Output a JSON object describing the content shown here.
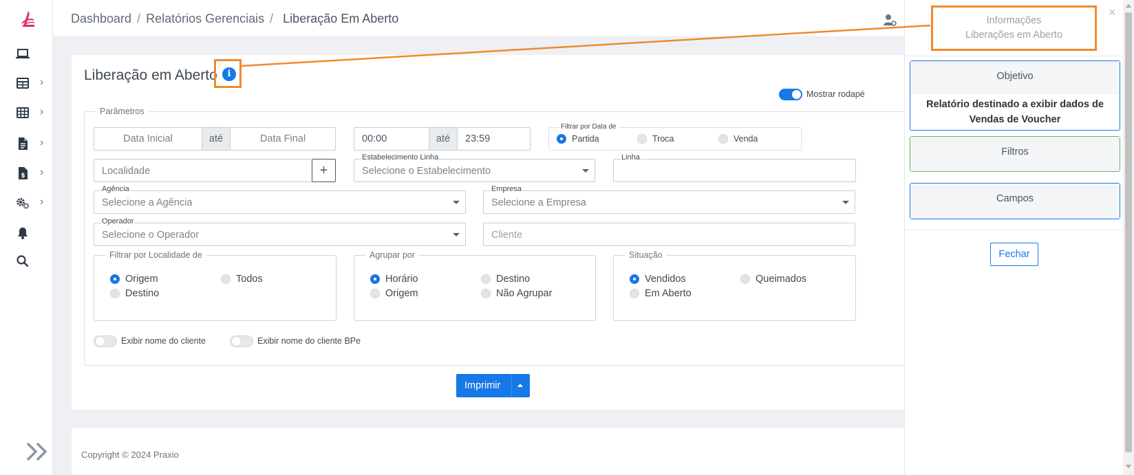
{
  "breadcrumb": {
    "items": [
      "Dashboard",
      "Relatórios Gerenciais"
    ],
    "separator": "/",
    "current": "Liberação Em Aberto"
  },
  "page": {
    "title": "Liberação em Aberto",
    "info_glyph": "i",
    "footer_toggle_label": "Mostrar rodapé"
  },
  "params": {
    "legend": "Parâmetros",
    "date_initial_placeholder": "Data Inicial",
    "date_separator": "até",
    "date_final_placeholder": "Data Final",
    "time_start": "00:00",
    "time_separator": "até",
    "time_end": "23:59",
    "filter_date_legend": "Filtrar por Data de",
    "filter_date_options": [
      "Partida",
      "Troca",
      "Venda"
    ],
    "filter_date_selected": "Partida",
    "localidade_placeholder": "Localidade",
    "add_glyph": "+",
    "estabelecimento_label": "Estabelecimento Linha",
    "estabelecimento_placeholder": "Selecione o Estabelecimento",
    "linha_label": "Linha",
    "agencia_label": "Agência",
    "agencia_placeholder": "Selecione a Agência",
    "empresa_label": "Empresa",
    "empresa_placeholder": "Selecione a Empresa",
    "operador_label": "Operador",
    "operador_placeholder": "Selecione o Operador",
    "cliente_placeholder": "Cliente",
    "localidade_group": {
      "legend": "Filtrar por Localidade de",
      "options": [
        "Origem",
        "Todos",
        "Destino"
      ],
      "selected": "Origem"
    },
    "agrupar_group": {
      "legend": "Agrupar por",
      "options": [
        "Horário",
        "Destino",
        "Origem",
        "Não Agrupar"
      ],
      "selected": "Horário"
    },
    "situacao_group": {
      "legend": "Situação",
      "options": [
        "Vendidos",
        "Queimados",
        "Em Aberto"
      ],
      "selected": "Vendidos"
    },
    "toggle_cliente_label": "Exibir nome do cliente",
    "toggle_cliente_bpe_label": "Exibir nome do cliente BPe"
  },
  "actions": {
    "print_label": "Imprimir"
  },
  "footer": {
    "copyright": "Copyright © 2024 Praxio"
  },
  "panel": {
    "title_line1": "Informações",
    "title_line2": "Liberações em Aberto",
    "close_glyph": "×",
    "sections": [
      {
        "title": "Objetivo",
        "body": "Relatório destinado a exibir dados de Vendas de Voucher"
      },
      {
        "title": "Filtros"
      },
      {
        "title": "Campos"
      }
    ],
    "close_button": "Fechar"
  },
  "colors": {
    "primary": "#1778e8",
    "highlight": "#f0892c",
    "logo": "#e0306a",
    "filtros_border": "#5cb85c"
  }
}
